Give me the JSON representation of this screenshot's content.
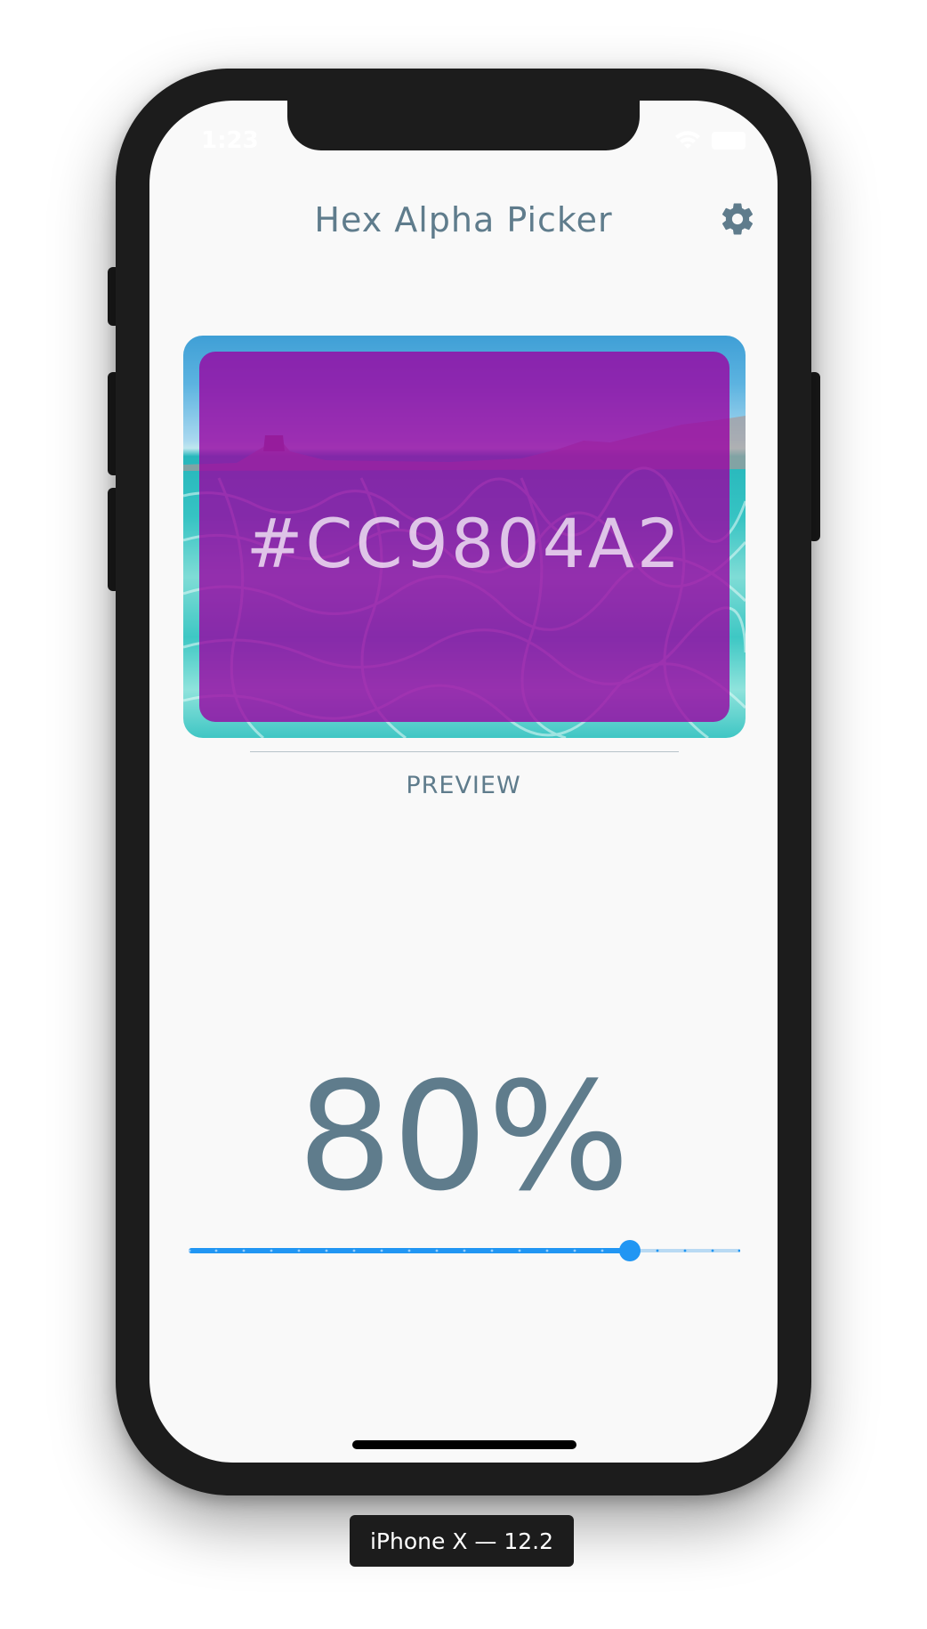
{
  "status_bar": {
    "time": "1:23"
  },
  "app": {
    "title": "Hex Alpha Picker",
    "settings_icon": "gear-icon"
  },
  "preview": {
    "hex_value": "#CC9804A2",
    "caption": "PREVIEW",
    "overlay_color": "#9804A2",
    "opacity": 0.8
  },
  "alpha": {
    "percent_label": "80%",
    "slider_value": 0.8,
    "slider_divisions": 20
  },
  "colors": {
    "accent": "#2196f3",
    "text_muted": "#5f7c8c",
    "background": "#f9f9f9"
  },
  "device_label": "iPhone X — 12.2"
}
